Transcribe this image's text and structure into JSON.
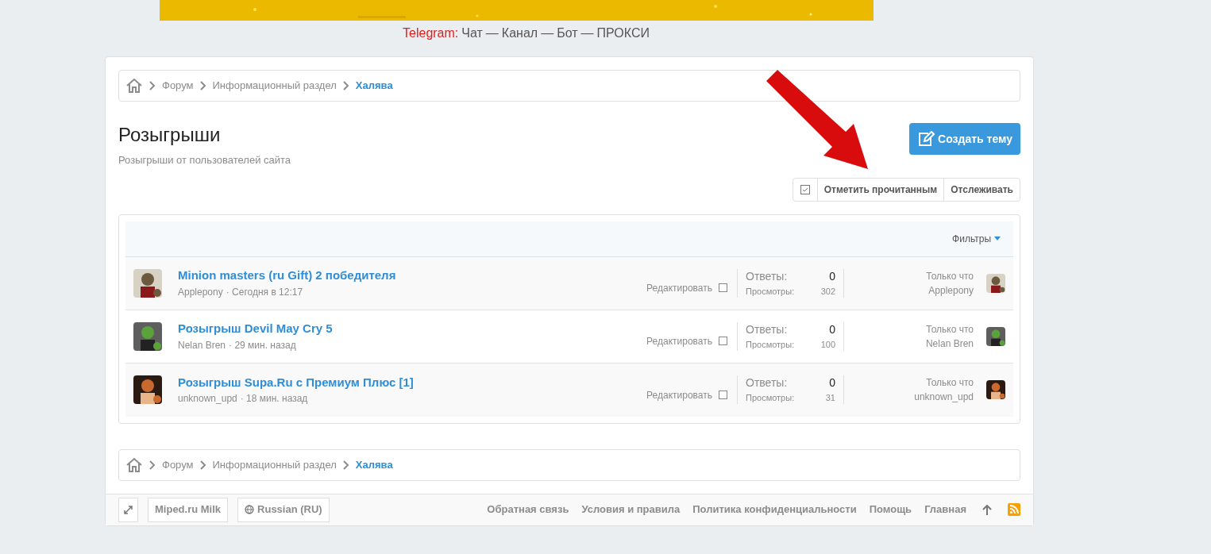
{
  "telegram": {
    "label": "Telegram:",
    "links": [
      "Чат",
      "—",
      "Канал",
      "—",
      "Бот",
      "—",
      "ПРОКСИ"
    ]
  },
  "breadcrumbs_top": [
    "Форум",
    "Информационный раздел",
    "Халява"
  ],
  "page": {
    "title": "Розыгрыши",
    "description": "Розыгрыши от пользователей сайта",
    "create_button": "Создать тему"
  },
  "actions": {
    "mark_read": "Отметить прочитанным",
    "watch": "Отслеживать"
  },
  "filters": "Фильтры",
  "threads": [
    {
      "title": "Minion masters (ru Gift) 2 победителя",
      "author": "Applepony",
      "sep": "·",
      "time": "Сегодня в 12:17",
      "edit": "Редактировать",
      "checked": false,
      "replies_label": "Ответы:",
      "replies": "0",
      "views_label": "Просмотры:",
      "views": "302",
      "last_time": "Только что",
      "last_user": "Applepony"
    },
    {
      "title": "Розыгрыш Devil May Cry 5",
      "author": "Nelan Bren",
      "sep": "·",
      "time": "29 мин. назад",
      "edit": "Редактировать",
      "checked": false,
      "replies_label": "Ответы:",
      "replies": "0",
      "views_label": "Просмотры:",
      "views": "100",
      "last_time": "Только что",
      "last_user": "Nelan Bren"
    },
    {
      "title": "Розыгрыш Supa.Ru с Премиум Плюс [1]",
      "author": "unknown_upd",
      "sep": "·",
      "time": "18 мин. назад",
      "edit": "Редактировать",
      "checked": false,
      "replies_label": "Ответы:",
      "replies": "0",
      "views_label": "Просмотры:",
      "views": "31",
      "last_time": "Только что",
      "last_user": "unknown_upd"
    }
  ],
  "breadcrumbs_bottom": [
    "Форум",
    "Информационный раздел",
    "Халява"
  ],
  "footer": {
    "style": "Miped.ru Milk",
    "language": "Russian (RU)",
    "links": [
      "Обратная связь",
      "Условия и правила",
      "Политика конфиденциальности",
      "Помощь",
      "Главная"
    ]
  }
}
